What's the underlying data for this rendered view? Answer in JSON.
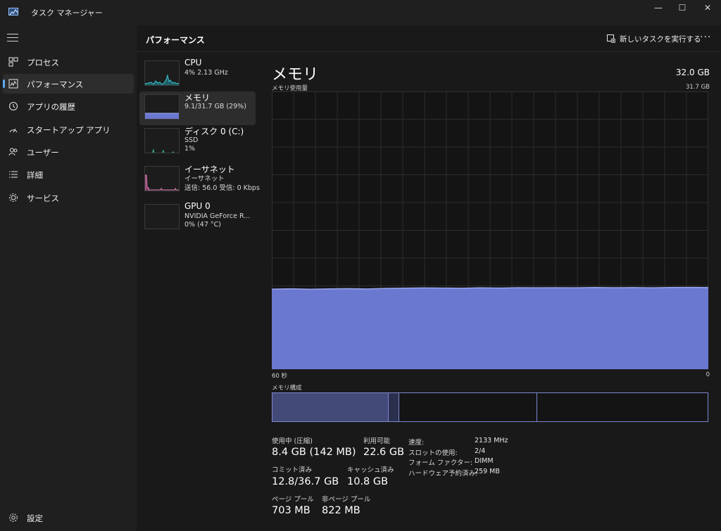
{
  "window": {
    "title": "タスク マネージャー",
    "controls": {
      "minimize": "—",
      "maximize": "☐",
      "close": "✕"
    }
  },
  "sidebar": {
    "menu_icon": "hamburger-icon",
    "items": [
      {
        "label": "プロセス",
        "icon": "processes-icon",
        "active": false
      },
      {
        "label": "パフォーマンス",
        "icon": "performance-icon",
        "active": true
      },
      {
        "label": "アプリの履歴",
        "icon": "history-icon",
        "active": false
      },
      {
        "label": "スタートアップ アプリ",
        "icon": "startup-icon",
        "active": false
      },
      {
        "label": "ユーザー",
        "icon": "users-icon",
        "active": false
      },
      {
        "label": "詳細",
        "icon": "details-icon",
        "active": false
      },
      {
        "label": "サービス",
        "icon": "services-icon",
        "active": false
      }
    ],
    "settings": {
      "label": "設定",
      "icon": "gear-icon"
    }
  },
  "header": {
    "title": "パフォーマンス",
    "new_task_label": "新しいタスクを実行する",
    "more_label": "···"
  },
  "resources": [
    {
      "name": "CPU",
      "line1": "4%  2.13 GHz",
      "line2": "",
      "active": false,
      "color": "#3dc4cf"
    },
    {
      "name": "メモリ",
      "line1": "9.1/31.7 GB (29%)",
      "line2": "",
      "active": true,
      "color": "#6f7fd9"
    },
    {
      "name": "ディスク 0 (C:)",
      "line1": "SSD",
      "line2": "1%",
      "active": false,
      "color": "#3dc48a"
    },
    {
      "name": "イーサネット",
      "line1": "イーサネット",
      "line2": "送信: 56.0  受信: 0 Kbps",
      "active": false,
      "color": "#e87fc0"
    },
    {
      "name": "GPU 0",
      "line1": "NVIDIA GeForce R...",
      "line2": "0%  (47 °C)",
      "active": false,
      "color": "#5aa0e0"
    }
  ],
  "detail": {
    "title": "メモリ",
    "total": "32.0 GB",
    "usage_label": "メモリ使用量",
    "usage_max": "31.7 GB",
    "graph_left_label": "60 秒",
    "graph_right_label": "0",
    "composition_label": "メモリ構成",
    "usage_fraction": 0.29,
    "graph_color": "#6a78d0",
    "graph_line_color": "#9aa6ee"
  },
  "stats": {
    "in_use_label": "使用中 (圧縮)",
    "in_use_value": "8.4 GB (142 MB)",
    "available_label": "利用可能",
    "available_value": "22.6 GB",
    "committed_label": "コミット済み",
    "committed_value": "12.8/36.7 GB",
    "cached_label": "キャッシュ済み",
    "cached_value": "10.8 GB",
    "paged_pool_label": "ページ プール",
    "paged_pool_value": "703 MB",
    "nonpaged_pool_label": "非ページ プール",
    "nonpaged_pool_value": "822 MB"
  },
  "properties": [
    {
      "label": "速度:",
      "value": "2133 MHz"
    },
    {
      "label": "スロットの使用:",
      "value": "2/4"
    },
    {
      "label": "フォーム ファクター:",
      "value": "DIMM"
    },
    {
      "label": "ハードウェア予約済み:",
      "value": "259 MB"
    }
  ]
}
